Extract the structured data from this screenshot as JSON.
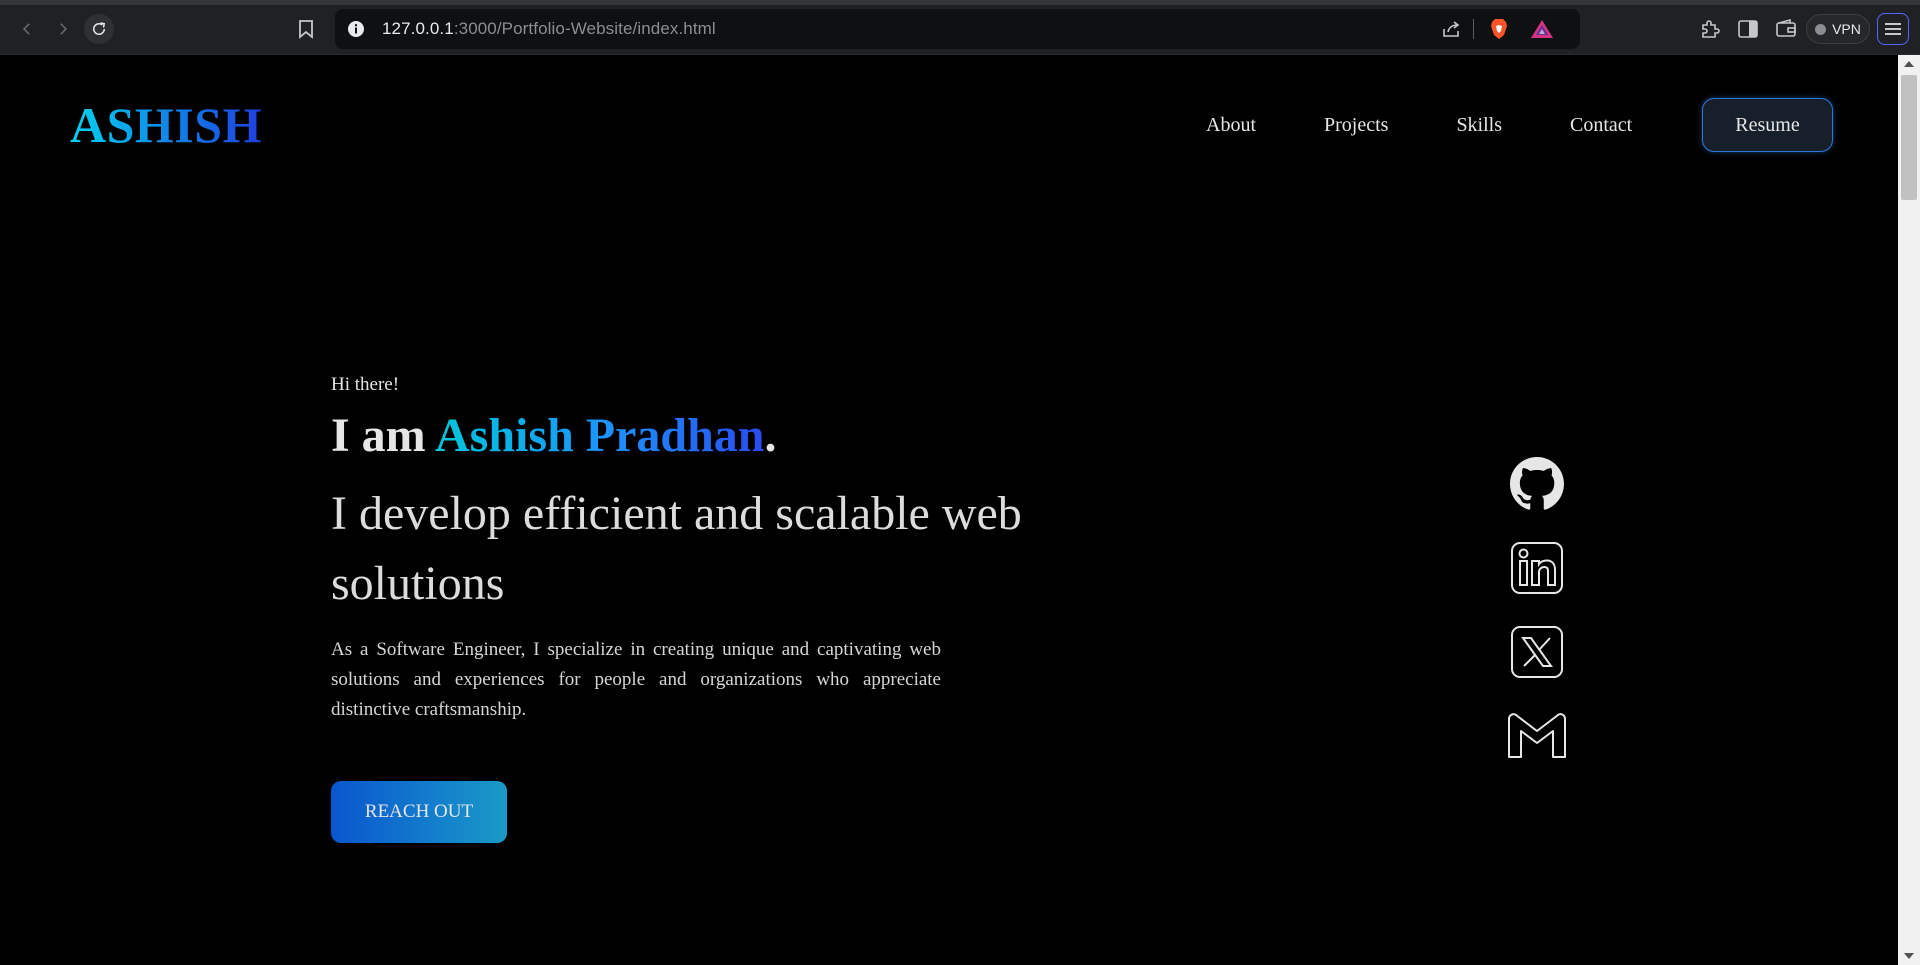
{
  "browser": {
    "url_host": "127.0.0.1",
    "url_path": ":3000/Portfolio-Website/index.html",
    "vpn_label": "VPN"
  },
  "header": {
    "logo": "ASHISH",
    "nav": [
      {
        "label": "About"
      },
      {
        "label": "Projects"
      },
      {
        "label": "Skills"
      },
      {
        "label": "Contact"
      }
    ],
    "resume_label": "Resume"
  },
  "hero": {
    "greeting": "Hi there!",
    "headline_prefix": "I am ",
    "name": "Ashish Pradhan",
    "headline_suffix": ".",
    "tagline": "I develop efficient and scalable web solutions",
    "intro": "As a Software Engineer, I specialize in creating unique and captivating web solutions and experiences for people and organizations who appreciate distinctive craftsmanship.",
    "cta_label": "REACH OUT"
  },
  "socials": [
    {
      "icon": "github-icon"
    },
    {
      "icon": "linkedin-icon"
    },
    {
      "icon": "x-twitter-icon"
    },
    {
      "icon": "gmail-icon"
    }
  ],
  "colors": {
    "background": "#000000",
    "text": "#e6e6e6",
    "accent_start": "#00d2f0",
    "accent_end": "#1f3fe0",
    "button_gradient_start": "#0a56d0",
    "button_gradient_end": "#1a9ac8"
  }
}
